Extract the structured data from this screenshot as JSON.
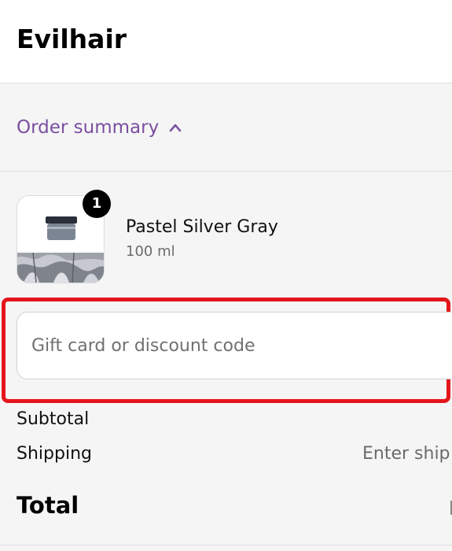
{
  "header": {
    "shop_name": "Evilhair"
  },
  "summary": {
    "toggle_label": "Order summary",
    "toggle_icon": "chevron-up-icon",
    "accent_color": "#7a4fa0"
  },
  "line_items": [
    {
      "quantity": "1",
      "title": "Pastel Silver Gray",
      "variant": "100 ml"
    }
  ],
  "discount": {
    "placeholder": "Gift card or discount code",
    "value": "",
    "highlight_color": "#e4161b"
  },
  "totals": {
    "subtotal_label": "Subtotal",
    "shipping_label": "Shipping",
    "shipping_value": "Enter ship",
    "total_label": "Total"
  }
}
